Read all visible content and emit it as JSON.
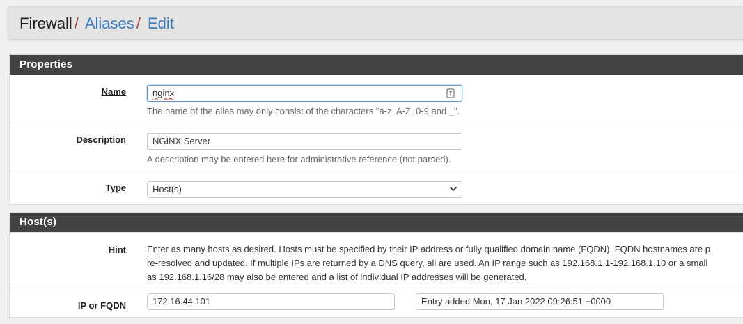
{
  "breadcrumb": {
    "root": "Firewall",
    "separator": "/",
    "items": [
      "Aliases",
      "Edit"
    ]
  },
  "properties": {
    "heading": "Properties",
    "name": {
      "label": "Name",
      "value": "nginx",
      "help": "The name of the alias may only consist of the characters \"a-z, A-Z, 0-9 and _\"."
    },
    "description": {
      "label": "Description",
      "value": "NGINX Server",
      "help": "A description may be entered here for administrative reference (not parsed)."
    },
    "type": {
      "label": "Type",
      "value": "Host(s)"
    }
  },
  "hosts": {
    "heading": "Host(s)",
    "hint_label": "Hint",
    "hint_lines": [
      "Enter as many hosts as desired. Hosts must be specified by their IP address or fully qualified domain name (FQDN). FQDN hostnames are p",
      "re-resolved and updated. If multiple IPs are returned by a DNS query, all are used. An IP range such as 192.168.1.1-192.168.1.10 or a small",
      "as 192.168.1.16/28 may also be entered and a list of individual IP addresses will be generated."
    ],
    "entry": {
      "label": "IP or FQDN",
      "address": "172.16.44.101",
      "description": "Entry added Mon, 17 Jan 2022 09:26:51 +0000"
    }
  },
  "colors": {
    "panel_heading": "#424242",
    "link": "#3b7bbf",
    "separator": "#a94442"
  }
}
